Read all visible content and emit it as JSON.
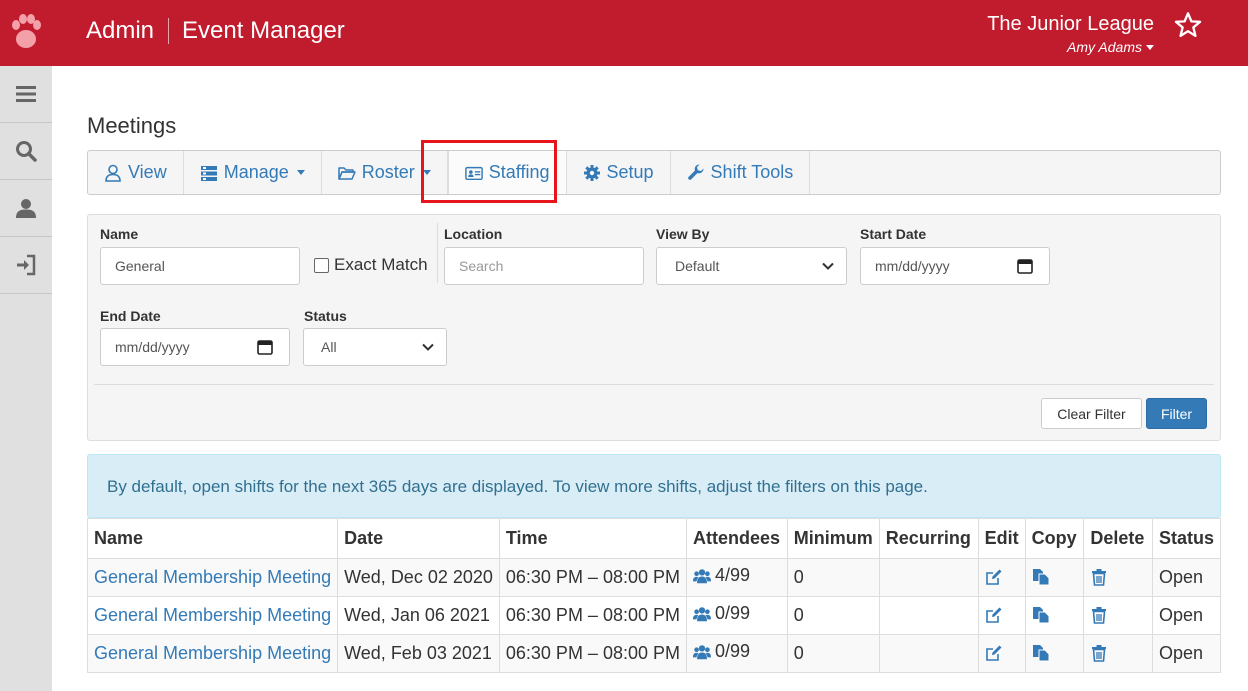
{
  "header": {
    "admin": "Admin",
    "app": "Event Manager",
    "org": "The Junior League",
    "user": "Amy Adams",
    "brand_color": "#c01c2e"
  },
  "sidebar": {
    "items": [
      {
        "icon": "menu-icon"
      },
      {
        "icon": "search-icon"
      },
      {
        "icon": "user-icon"
      },
      {
        "icon": "sign-in-icon"
      }
    ]
  },
  "page": {
    "title": "Meetings"
  },
  "toolbar": {
    "view": "View",
    "manage": "Manage",
    "roster": "Roster",
    "staffing": "Staffing",
    "setup": "Setup",
    "shift_tools": "Shift Tools"
  },
  "filters": {
    "name_label": "Name",
    "name_value": "General",
    "exact_match": "Exact Match",
    "location_label": "Location",
    "location_placeholder": "Search",
    "view_by_label": "View By",
    "view_by_value": "Default",
    "start_date_label": "Start Date",
    "start_date_placeholder": "mm/dd/yyyy",
    "end_date_label": "End Date",
    "end_date_placeholder": "mm/dd/yyyy",
    "status_label": "Status",
    "status_value": "All",
    "clear_button": "Clear Filter",
    "filter_button": "Filter"
  },
  "info": {
    "message": "By default, open shifts for the next 365 days are displayed. To view more shifts, adjust the filters on this page."
  },
  "table": {
    "headers": [
      "Name",
      "Date",
      "Time",
      "Attendees",
      "Minimum",
      "Recurring",
      "Edit",
      "Copy",
      "Delete",
      "Status"
    ],
    "rows": [
      {
        "name": "General Membership Meeting",
        "date": "Wed, Dec 02 2020",
        "time": "06:30 PM – 08:00 PM",
        "attendees": "4/99",
        "minimum": "0",
        "recurring": "",
        "status": "Open"
      },
      {
        "name": "General Membership Meeting",
        "date": "Wed, Jan 06 2021",
        "time": "06:30 PM – 08:00 PM",
        "attendees": "0/99",
        "minimum": "0",
        "recurring": "",
        "status": "Open"
      },
      {
        "name": "General Membership Meeting",
        "date": "Wed, Feb 03 2021",
        "time": "06:30 PM – 08:00 PM",
        "attendees": "0/99",
        "minimum": "0",
        "recurring": "",
        "status": "Open"
      }
    ]
  }
}
